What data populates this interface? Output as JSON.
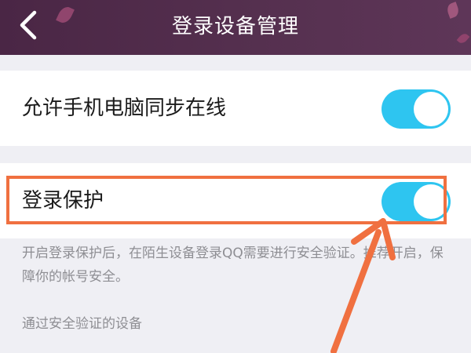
{
  "header": {
    "title": "登录设备管理",
    "back_icon": "chevron-left-icon"
  },
  "settings": {
    "sync_online": {
      "label": "允许手机电脑同步在线",
      "enabled": true
    },
    "login_protection": {
      "label": "登录保护",
      "enabled": true,
      "description": "开启登录保护后，在陌生设备登录QQ需要进行安全验证。推荐开启，保障你的帐号安全。"
    },
    "verified_devices_section": "通过安全验证的设备"
  },
  "colors": {
    "header_background": "#4a2645",
    "toggle_on": "#2ec5f0",
    "annotation": "#f07040",
    "page_background": "#efeff4"
  }
}
